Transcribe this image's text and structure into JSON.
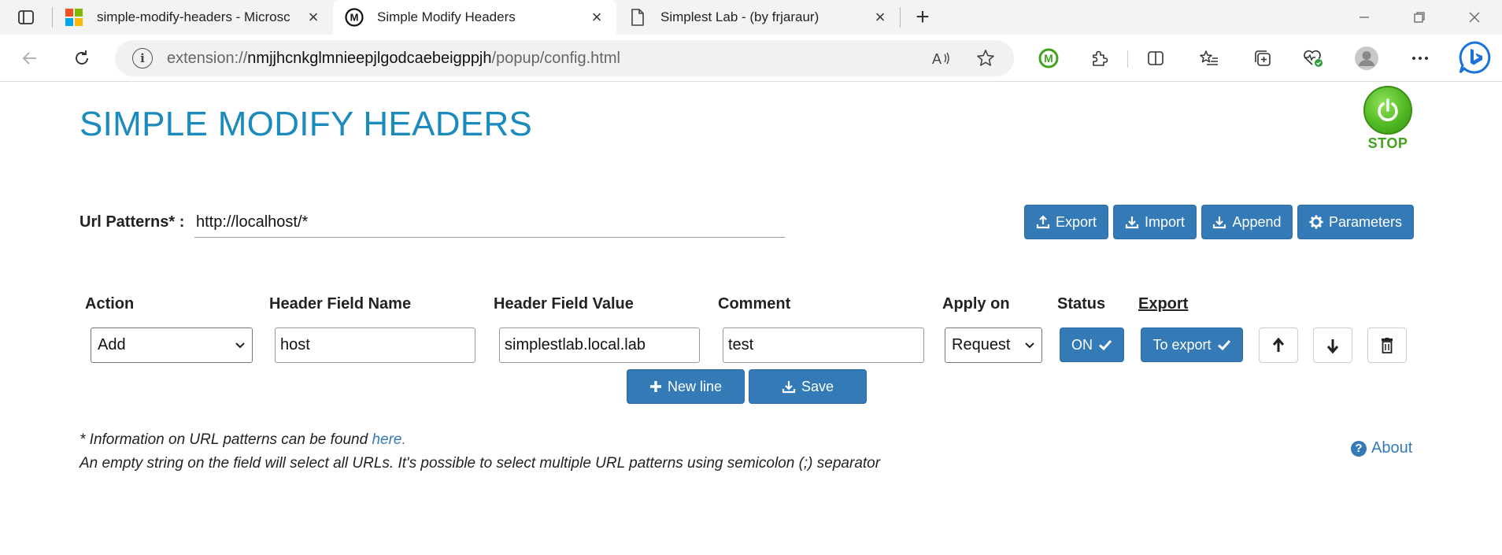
{
  "browser": {
    "tabs": [
      {
        "title": "simple-modify-headers - Microsc",
        "icon": "microsoft-logo-icon"
      },
      {
        "title": "Simple Modify Headers",
        "icon": "extension-m-icon"
      },
      {
        "title": "Simplest Lab - (by frjaraur)",
        "icon": "document-icon"
      }
    ],
    "new_tab_label": "+",
    "url_prefix": "extension://",
    "url_host": "nmjjhcnkglmnieepjlgodcaebeigppjh",
    "url_path": "/popup/config.html"
  },
  "app": {
    "title": "SIMPLE MODIFY HEADERS",
    "stop_label": "STOP",
    "url_patterns_label": "Url Patterns* :",
    "url_patterns_value": "http://localhost/*",
    "buttons": {
      "export": "Export",
      "import": "Import",
      "append": "Append",
      "parameters": "Parameters",
      "new_line": "New line",
      "save": "Save"
    },
    "columns": {
      "action": "Action",
      "header_name": "Header Field Name",
      "header_value": "Header Field Value",
      "comment": "Comment",
      "apply_on": "Apply on",
      "status": "Status",
      "export": "Export"
    },
    "rows": [
      {
        "action": "Add",
        "header_name": "host",
        "header_value": "simplestlab.local.lab",
        "comment": "test",
        "apply_on": "Request",
        "status": "ON",
        "export": "To export"
      }
    ],
    "info_line1": "* Information on URL patterns can be found",
    "info_link": "here.",
    "info_line2": "An empty string on the field will select all URLs. It's possible to select multiple URL patterns using semicolon (;) separator",
    "about": "About"
  },
  "colors": {
    "title": "#1b8bbd",
    "primary_button": "#337ab7",
    "stop_green": "#4cb51f"
  }
}
